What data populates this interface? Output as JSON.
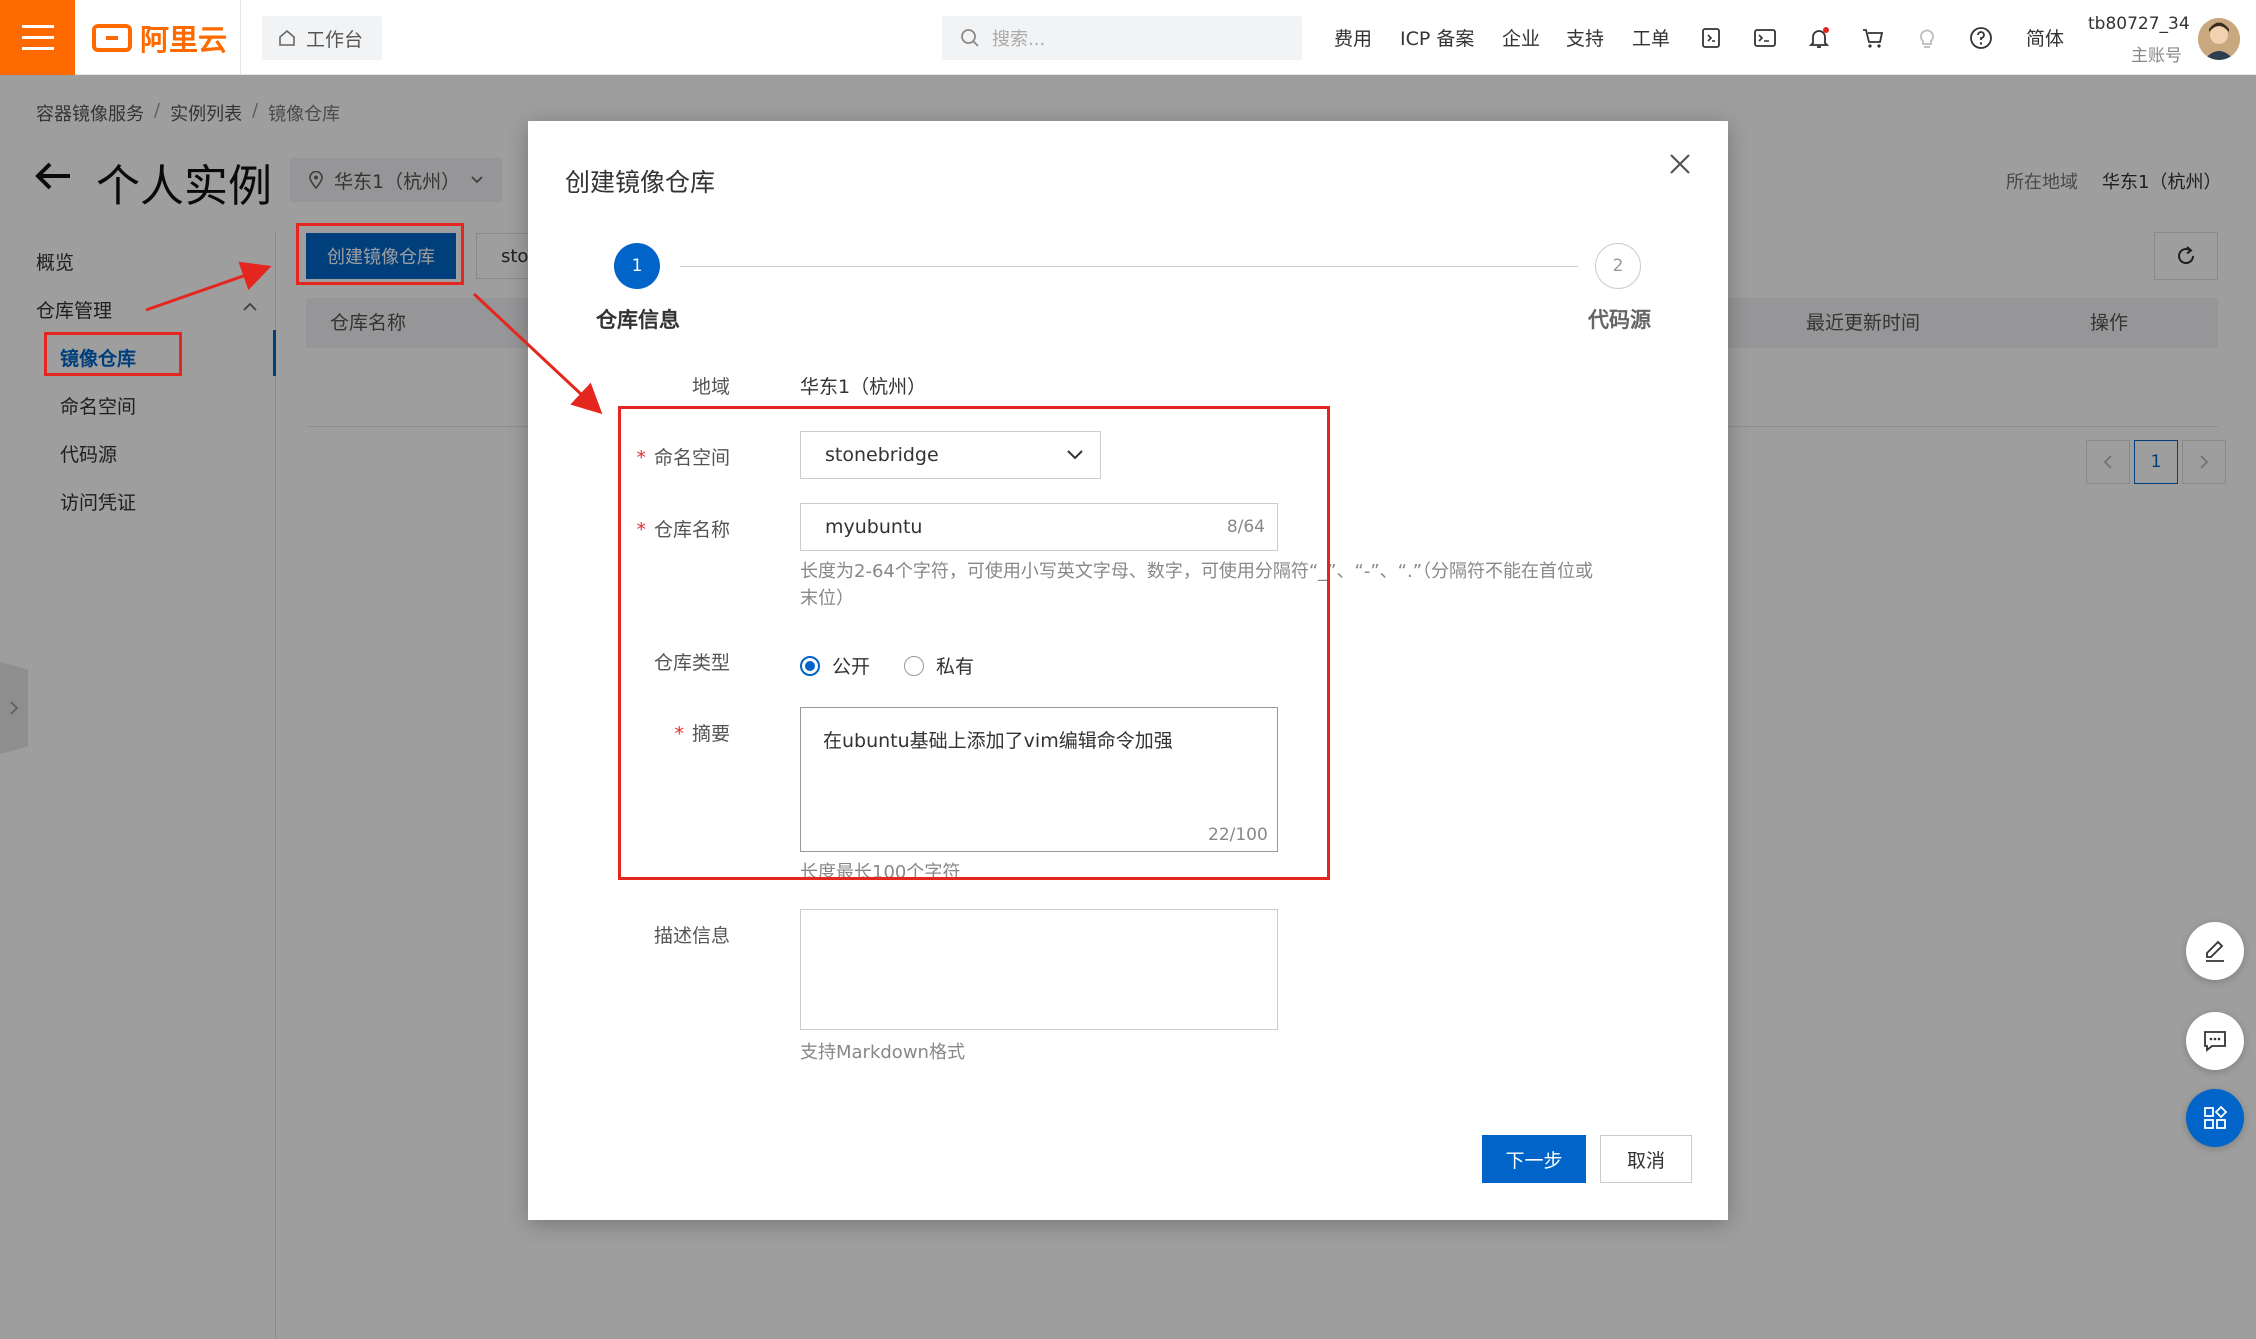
{
  "topbar": {
    "brand": "阿里云",
    "workbench": "工作台",
    "search_placeholder": "搜索...",
    "nav": [
      "费用",
      "ICP 备案",
      "企业",
      "支持",
      "工单"
    ],
    "lang": "简体",
    "user_name": "tb80727_34",
    "user_sub": "主账号"
  },
  "breadcrumb": [
    "容器镜像服务",
    "实例列表",
    "镜像仓库"
  ],
  "page": {
    "title": "个人实例",
    "region": "华东1（杭州）",
    "location_label": "所在地域",
    "location_value": "华东1（杭州）"
  },
  "sidebar": {
    "overview": "概览",
    "group": "仓库管理",
    "items": [
      "镜像仓库",
      "命名空间",
      "代码源",
      "访问凭证"
    ]
  },
  "toolbar": {
    "create_button": "创建镜像仓库",
    "namespace_filter": "stor"
  },
  "table": {
    "columns": {
      "name": "仓库名称",
      "updated": "最近更新时间",
      "ops": "操作"
    },
    "pager_current": "1"
  },
  "dialog": {
    "title": "创建镜像仓库",
    "steps": [
      {
        "num": "1",
        "label": "仓库信息"
      },
      {
        "num": "2",
        "label": "代码源"
      }
    ],
    "fields": {
      "region_label": "地域",
      "region_value": "华东1（杭州）",
      "namespace_label": "命名空间",
      "namespace_value": "stonebridge",
      "repo_name_label": "仓库名称",
      "repo_name_value": "myubuntu",
      "repo_name_count": "8/64",
      "repo_name_hint": "长度为2-64个字符，可使用小写英文字母、数字，可使用分隔符“_”、“-”、“.”（分隔符不能在首位或末位）",
      "type_label": "仓库类型",
      "type_public": "公开",
      "type_private": "私有",
      "summary_label": "摘要",
      "summary_value": "在ubuntu基础上添加了vim编辑命令加强",
      "summary_count": "22/100",
      "summary_hint": "长度最长100个字符",
      "desc_label": "描述信息",
      "desc_hint": "支持Markdown格式"
    },
    "next_button": "下一步",
    "cancel_button": "取消"
  },
  "colors": {
    "brand_orange": "#ff6a00",
    "primary_blue": "#0064c8",
    "annotation_red": "#e5261f"
  }
}
